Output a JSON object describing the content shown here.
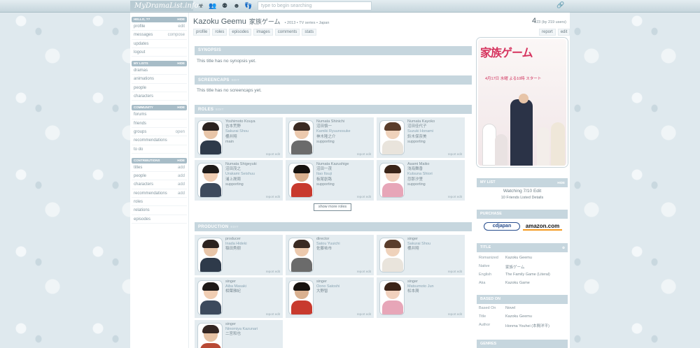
{
  "topbar": {
    "logo": "MyDramaList.info",
    "search_placeholder": "type to begin searching",
    "icons": [
      "biohazard-icon",
      "users-icon",
      "gang-icon",
      "guy-icon",
      "footprints-icon"
    ],
    "right_icon": "link-icon"
  },
  "sidebar": {
    "boxes": [
      {
        "title": "Hello, ??",
        "action": "hide",
        "items": [
          {
            "label": "profile",
            "right": "edit"
          },
          {
            "label": "messages",
            "right": "compose"
          },
          {
            "label": "updates",
            "right": ""
          },
          {
            "label": "logout",
            "right": ""
          }
        ]
      },
      {
        "title": "My Lists",
        "action": "hide",
        "items": [
          {
            "label": "dramas",
            "right": ""
          },
          {
            "label": "animations",
            "right": ""
          },
          {
            "label": "people",
            "right": ""
          },
          {
            "label": "characters",
            "right": ""
          }
        ]
      },
      {
        "title": "Community",
        "action": "hide",
        "items": [
          {
            "label": "forums",
            "right": ""
          },
          {
            "label": "friends",
            "right": ""
          },
          {
            "label": "groups",
            "right": "open"
          },
          {
            "label": "recommendations",
            "right": ""
          },
          {
            "label": "to do",
            "right": ""
          }
        ]
      },
      {
        "title": "Contributions",
        "action": "hide",
        "items": [
          {
            "label": "titles",
            "right": "add"
          },
          {
            "label": "people",
            "right": "add"
          },
          {
            "label": "characters",
            "right": "add"
          },
          {
            "label": "recommendations",
            "right": "add"
          },
          {
            "label": "roles",
            "right": ""
          },
          {
            "label": "relations",
            "right": ""
          },
          {
            "label": "episodes",
            "right": ""
          }
        ]
      }
    ]
  },
  "title": {
    "name": "Kazoku Geemu",
    "native": "家族ゲーム",
    "meta": "• 2013  • TV series  • Japan",
    "score": "4",
    "users": "23 (by 219 users)"
  },
  "tabs": [
    "profile",
    "roles",
    "episodes",
    "images",
    "comments",
    "stats"
  ],
  "right_tabs": [
    "report",
    "edit"
  ],
  "synopsis": {
    "header": "Synopsis",
    "edit": "edit",
    "text": "This title has no synopsis yet."
  },
  "screencaps": {
    "header": "Screencaps",
    "edit": "edit",
    "text": "This title has no screencaps yet."
  },
  "roles": {
    "header": "Roles",
    "edit": "edit",
    "more_button": "show more roles",
    "card_edit": "report edit",
    "cards": [
      {
        "name": "Yoshimoto Kouya",
        "native": "吉本荒野",
        "actor": "Sakurai Shou",
        "actor_native": "櫻井翔",
        "role": "main"
      },
      {
        "name": "Numata Shinichi",
        "native": "沼田慎一",
        "actor": "Kamiki Ryuunosuke",
        "actor_native": "神木隆之介",
        "role": "supporting"
      },
      {
        "name": "Numata Kayoko",
        "native": "沼田佳代子",
        "actor": "Suzuki Honami",
        "actor_native": "鈴木保奈美",
        "role": "supporting"
      },
      {
        "name": "Numata Shigeyuki",
        "native": "沼田茂之",
        "actor": "Urakami Seishuu",
        "actor_native": "浦上晟周",
        "role": "supporting"
      },
      {
        "name": "Numata Kazushige",
        "native": "沼田一茂",
        "actor": "Itao Itsuji",
        "actor_native": "板尾創路",
        "role": "supporting"
      },
      {
        "name": "Asami Maiko",
        "native": "浅海舞香",
        "actor": "Kutsuna Shiori",
        "actor_native": "忽那汐里",
        "role": "supporting"
      }
    ]
  },
  "production": {
    "header": "Production",
    "edit": "edit",
    "card_edit": "report edit",
    "cards": [
      {
        "role": "producer",
        "name": "Inada Hideki",
        "native": "稲田秀樹"
      },
      {
        "role": "director",
        "name": "Satou Yuuichi",
        "native": "佐藤祐市"
      },
      {
        "role": "singer",
        "name": "Sakurai Shou",
        "native": "櫻井翔"
      },
      {
        "role": "singer",
        "name": "Aiba Masaki",
        "native": "相葉雅紀"
      },
      {
        "role": "singer",
        "name": "Oono Satoshi",
        "native": "大野智"
      },
      {
        "role": "singer",
        "name": "Matsumoto Jun",
        "native": "松本潤"
      },
      {
        "role": "singer",
        "name": "Ninomiya Kazunari",
        "native": "二宮和也"
      }
    ]
  },
  "poster": {
    "title": "家族ゲーム",
    "date": "4月17日 水曜 よる10時 スタート"
  },
  "mylist": {
    "header": "My List",
    "action": "hide",
    "status": "Watching 7/10 Edit",
    "friends": "10 Friends Listed Details"
  },
  "purchase": {
    "header": "Purchase",
    "cdjapan": "cdjapan",
    "amazon": "amazon.com"
  },
  "titles": {
    "header": "Title",
    "rows": [
      {
        "k": "Romanized",
        "v": "Kazoku Geemu"
      },
      {
        "k": "Native",
        "v": "家族ゲーム"
      },
      {
        "k": "English",
        "v": "The Family Game (Literal)"
      },
      {
        "k": "Aka",
        "v": "Kazoku Game"
      }
    ]
  },
  "based": {
    "header": "Based On",
    "rows": [
      {
        "k": "Based On",
        "v": "Novel"
      },
      {
        "k": "Title",
        "v": "Kazoku Geemu"
      },
      {
        "k": "Author",
        "v": "Honma Youhei (本間洋平)"
      }
    ]
  },
  "genres": {
    "header": "Genres"
  }
}
